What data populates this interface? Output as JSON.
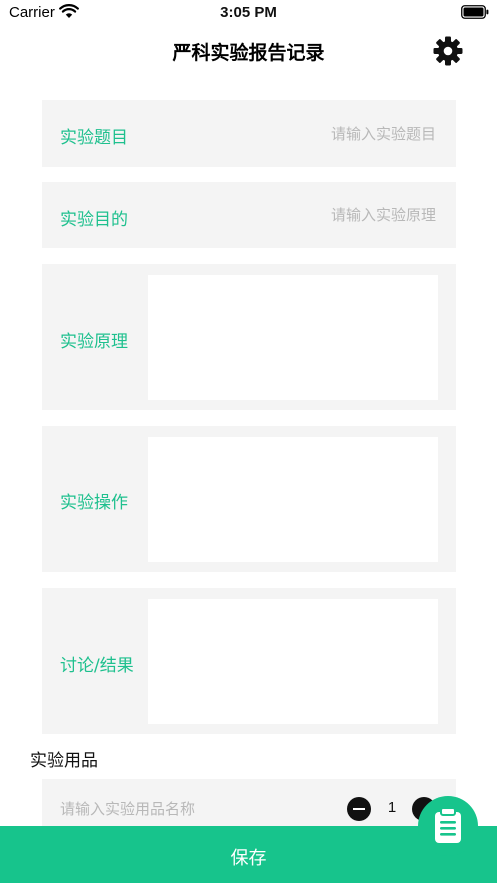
{
  "status_bar": {
    "carrier": "Carrier",
    "time": "3:05 PM"
  },
  "nav": {
    "title": "严科实验报告记录",
    "settings_icon": "gear-icon"
  },
  "fields": {
    "title": {
      "label": "实验题目",
      "placeholder": "请输入实验题目"
    },
    "purpose": {
      "label": "实验目的",
      "placeholder": "请输入实验原理"
    },
    "principle": {
      "label": "实验原理"
    },
    "operation": {
      "label": "实验操作"
    },
    "discussion": {
      "label": "讨论/结果"
    }
  },
  "supplies": {
    "heading": "实验用品",
    "name_placeholder": "请输入实验用品名称",
    "quantity": "1"
  },
  "actions": {
    "save_label": "保存",
    "fab_icon": "clipboard-icon"
  },
  "colors": {
    "accent": "#17c48c",
    "label_green": "#1ec08e",
    "row_bg": "#f4f4f4"
  }
}
